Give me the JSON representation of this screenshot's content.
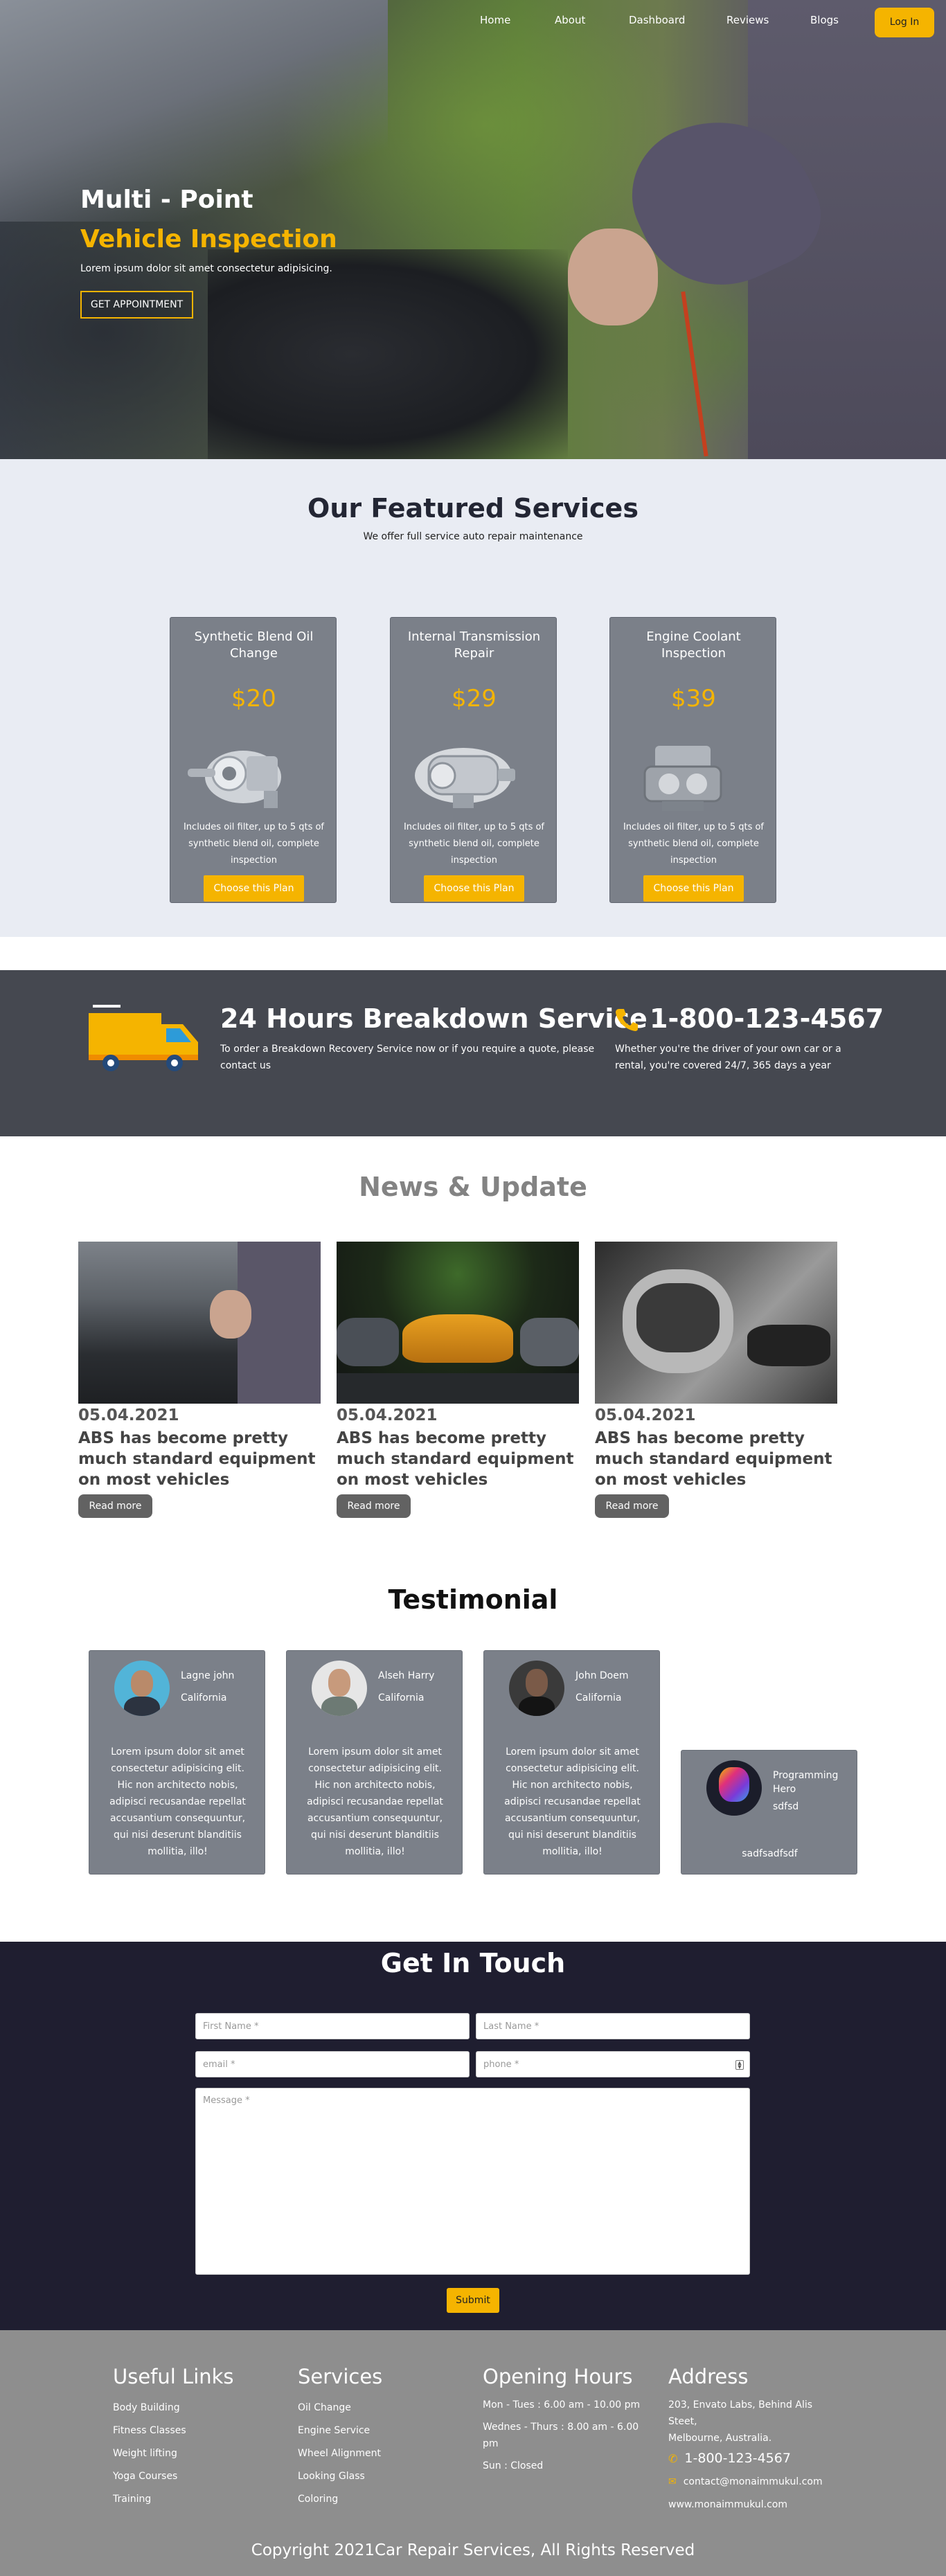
{
  "nav": {
    "items": [
      "Home",
      "About",
      "Dashboard",
      "Reviews",
      "Blogs"
    ],
    "login_label": "Log In"
  },
  "hero": {
    "title_line1": "Multi - Point",
    "title_line2": "Vehicle Inspection",
    "subtitle": "Lorem ipsum dolor sit amet consectetur adipisicing.",
    "button_label": "GET APPOINTMENT"
  },
  "services": {
    "title": "Our Featured Services",
    "subtitle": "We offer full service auto repair maintenance",
    "cards": [
      {
        "name": "Synthetic Blend Oil Change",
        "price": "$20",
        "description": "Includes oil filter, up to 5 qts of synthetic blend oil, complete inspection",
        "button": "Choose this Plan"
      },
      {
        "name": "Internal Transmission Repair",
        "price": "$29",
        "description": "Includes oil filter, up to 5 qts of synthetic blend oil, complete inspection",
        "button": "Choose this Plan"
      },
      {
        "name": "Engine Coolant Inspection",
        "price": "$39",
        "description": "Includes oil filter, up to 5 qts of synthetic blend oil, complete inspection",
        "button": "Choose this Plan"
      }
    ]
  },
  "breakdown": {
    "title": "24 Hours Breakdown Service",
    "description": "To order a Breakdown Recovery Service now or if you require a quote, please contact us",
    "phone": "1-800-123-4567",
    "phone_description": "Whether you're the driver of your own car or a rental, you're covered 24/7, 365 days a year"
  },
  "news": {
    "title": "News & Update",
    "items": [
      {
        "date": "05.04.2021",
        "title": "ABS has become pretty much standard equipment on most vehicles",
        "button": "Read more"
      },
      {
        "date": "05.04.2021",
        "title": "ABS has become pretty much standard equipment on most vehicles",
        "button": "Read more"
      },
      {
        "date": "05.04.2021",
        "title": "ABS has become pretty much standard equipment on most vehicles",
        "button": "Read more"
      }
    ]
  },
  "testimonial": {
    "title": "Testimonial",
    "items": [
      {
        "name": "Lagne john",
        "location": "California",
        "quote": "Lorem ipsum dolor sit amet consectetur adipisicing elit. Hic non architecto nobis, adipisci recusandae repellat accusantium consequuntur, qui nisi deserunt blanditiis mollitia, illo!"
      },
      {
        "name": "Alseh Harry",
        "location": "California",
        "quote": "Lorem ipsum dolor sit amet consectetur adipisicing elit. Hic non architecto nobis, adipisci recusandae repellat accusantium consequuntur, qui nisi deserunt blanditiis mollitia, illo!"
      },
      {
        "name": "John Doem",
        "location": "California",
        "quote": "Lorem ipsum dolor sit amet consectetur adipisicing elit. Hic non architecto nobis, adipisci recusandae repellat accusantium consequuntur, qui nisi deserunt blanditiis mollitia, illo!"
      },
      {
        "name": "Programming Hero",
        "location": "sdfsd",
        "quote": "sadfsadfsdf"
      }
    ]
  },
  "contact": {
    "title": "Get In Touch",
    "first_name_placeholder": "First Name *",
    "last_name_placeholder": "Last Name *",
    "email_placeholder": "email *",
    "phone_placeholder": "phone *",
    "message_placeholder": "Message *",
    "submit_label": "Submit"
  },
  "footer": {
    "useful_links": {
      "title": "Useful Links",
      "items": [
        "Body Building",
        "Fitness Classes",
        "Weight lifting",
        "Yoga Courses",
        "Training"
      ]
    },
    "services": {
      "title": "Services",
      "items": [
        "Oil Change",
        "Engine Service",
        "Wheel Alignment",
        "Looking Glass",
        "Coloring"
      ]
    },
    "hours": {
      "title": "Opening Hours",
      "line1": "Mon - Tues : 6.00 am - 10.00 pm",
      "line2": "Wednes - Thurs : 8.00 am - 6.00 pm",
      "line3": "Sun : Closed"
    },
    "address": {
      "title": "Address",
      "line1": "203, Envato Labs, Behind Alis Steet,",
      "line2": "Melbourne, Australia.",
      "phone": "1-800-123-4567",
      "email": "contact@monaimmukul.com",
      "website": "www.monaimmukul.com"
    },
    "copyright": "Copyright 2021Car Repair Services, All Rights Reserved"
  },
  "colors": {
    "accent": "#f5b400",
    "dark_band": "#454850",
    "contact_bg": "#1f1e30",
    "footer_bg": "#8e8e8e"
  }
}
